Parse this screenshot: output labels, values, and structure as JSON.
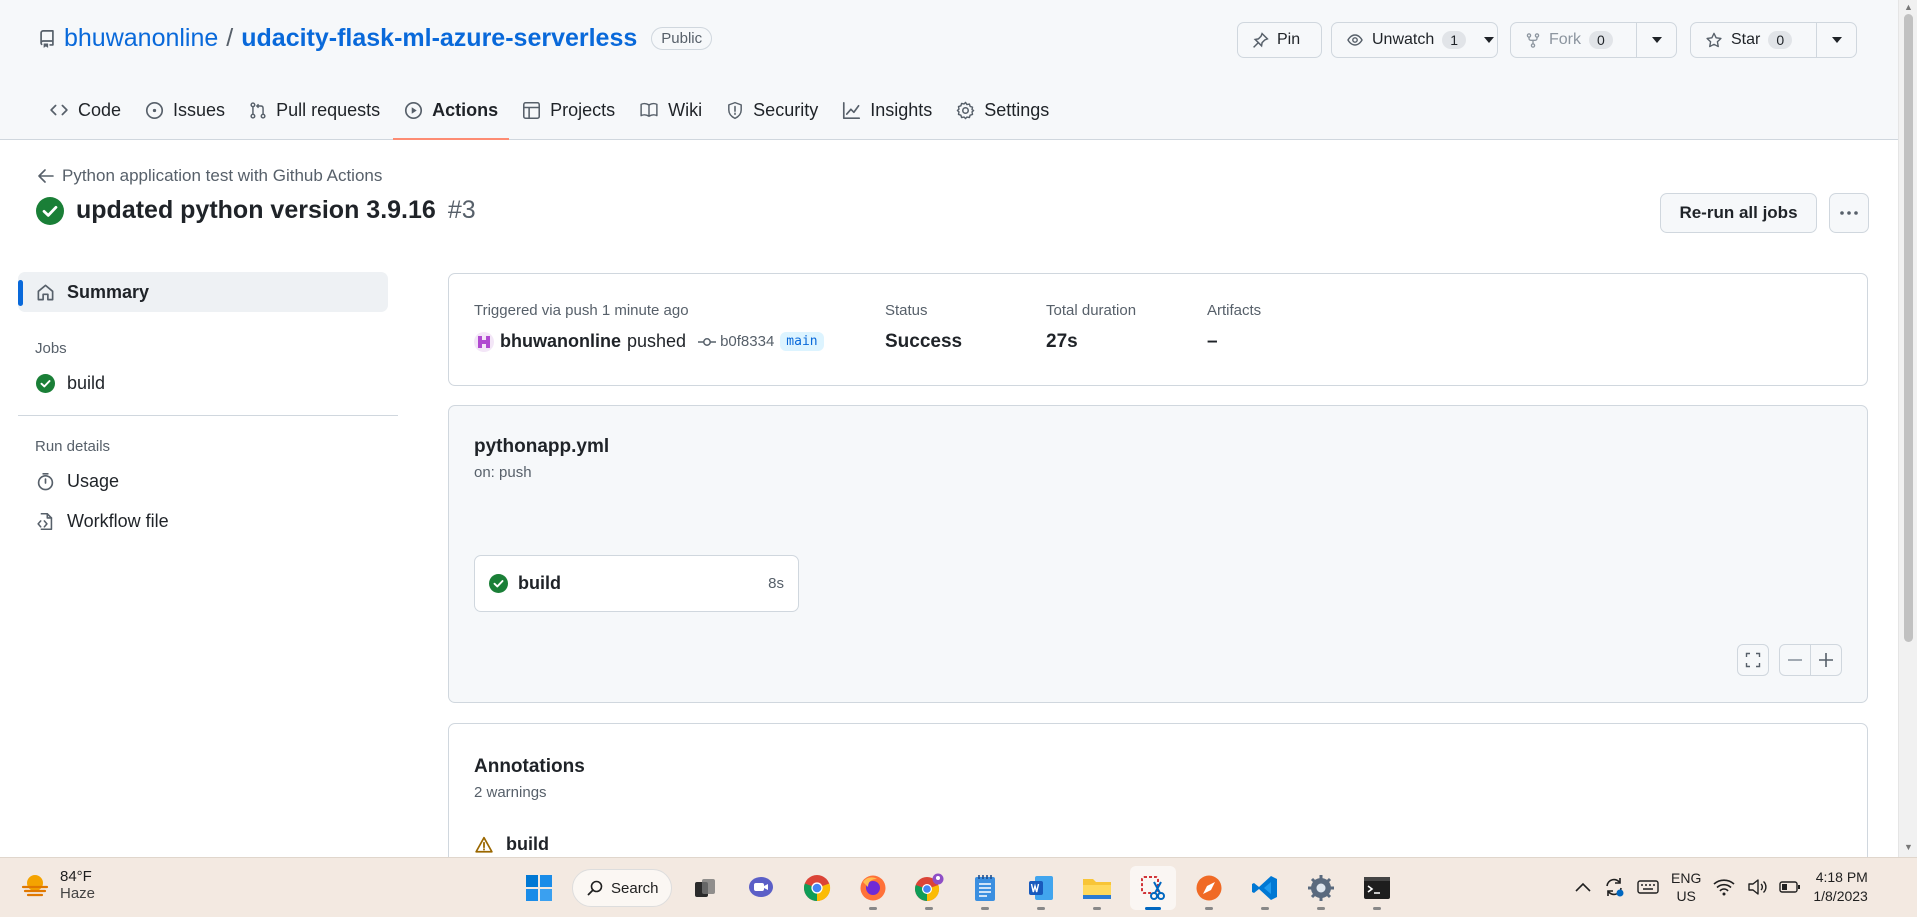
{
  "repo": {
    "owner": "bhuwanonline",
    "separator": "/",
    "name": "udacity-flask-ml-azure-serverless",
    "visibility": "Public",
    "actions": {
      "pin_label": "Pin",
      "unwatch_label": "Unwatch",
      "unwatch_count": "1",
      "fork_label": "Fork",
      "fork_count": "0",
      "star_label": "Star",
      "star_count": "0"
    },
    "tabs": [
      {
        "label": "Code",
        "icon": "code-icon"
      },
      {
        "label": "Issues",
        "icon": "issue-icon"
      },
      {
        "label": "Pull requests",
        "icon": "pull-request-icon"
      },
      {
        "label": "Actions",
        "icon": "play-icon",
        "active": true
      },
      {
        "label": "Projects",
        "icon": "table-icon"
      },
      {
        "label": "Wiki",
        "icon": "book-icon"
      },
      {
        "label": "Security",
        "icon": "shield-icon"
      },
      {
        "label": "Insights",
        "icon": "graph-icon"
      },
      {
        "label": "Settings",
        "icon": "gear-icon"
      }
    ]
  },
  "run": {
    "back_link": "Python application test with Github Actions",
    "title": "updated python version 3.9.16",
    "number": "#3",
    "rerun_label": "Re-run all jobs"
  },
  "sidebar": {
    "summary_label": "Summary",
    "jobs_heading": "Jobs",
    "jobs": [
      {
        "label": "build",
        "status": "success"
      }
    ],
    "run_details_heading": "Run details",
    "details": [
      {
        "label": "Usage",
        "icon": "stopwatch-icon"
      },
      {
        "label": "Workflow file",
        "icon": "file-code-icon"
      }
    ]
  },
  "summary": {
    "trigger_label": "Triggered via push 1 minute ago",
    "actor": "bhuwanonline",
    "pushed": "pushed",
    "sha": "b0f8334",
    "branch": "main",
    "status_label": "Status",
    "status_value": "Success",
    "duration_label": "Total duration",
    "duration_value": "27s",
    "artifacts_label": "Artifacts",
    "artifacts_value": "–"
  },
  "workflow": {
    "file": "pythonapp.yml",
    "trigger": "on: push",
    "job_name": "build",
    "job_duration": "8s"
  },
  "annotations": {
    "title": "Annotations",
    "subtitle": "2 warnings",
    "first_item": "build"
  },
  "taskbar": {
    "weather_temp": "84°F",
    "weather_cond": "Haze",
    "search_label": "Search",
    "lang_top": "ENG",
    "lang_bottom": "US",
    "time": "4:18 PM",
    "date": "1/8/2023"
  },
  "colors": {
    "accent": "#0969da",
    "success": "#1a7f37",
    "active_tab_underline": "#fd8c73",
    "warning": "#9a6700"
  }
}
